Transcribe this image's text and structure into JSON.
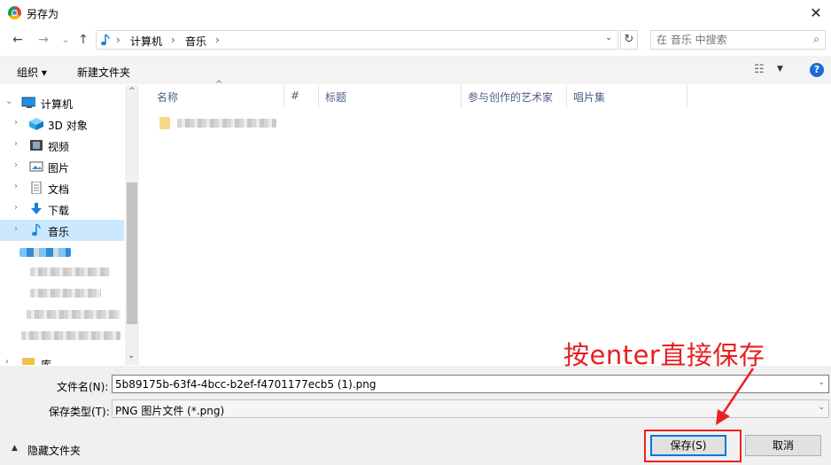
{
  "window": {
    "title": "另存为",
    "close": "✕"
  },
  "nav": {
    "back": "←",
    "forward": "→",
    "recent": "⌄",
    "up": "↑"
  },
  "address": {
    "segments": [
      "计算机",
      "音乐"
    ],
    "sep": "›",
    "dropdown": "⌄",
    "refresh": "↻"
  },
  "search": {
    "placeholder": "在 音乐 中搜索",
    "icon": "⌕"
  },
  "toolbar": {
    "organize": "组织 ▾",
    "new_folder": "新建文件夹",
    "help": "?"
  },
  "sidebar": {
    "items": [
      {
        "label": "计算机",
        "icon": "computer-icon"
      },
      {
        "label": "3D 对象",
        "icon": "cube-icon"
      },
      {
        "label": "视频",
        "icon": "video-icon"
      },
      {
        "label": "图片",
        "icon": "pictures-icon"
      },
      {
        "label": "文档",
        "icon": "document-icon"
      },
      {
        "label": "下载",
        "icon": "download-icon"
      },
      {
        "label": "音乐",
        "icon": "music-icon"
      },
      {
        "label": "库",
        "icon": "library-icon"
      }
    ],
    "selected": "音乐"
  },
  "columns": [
    "名称",
    "#",
    "标题",
    "参与创作的艺术家",
    "唱片集"
  ],
  "form": {
    "filename_label": "文件名(N):",
    "filename_value": "5b89175b-63f4-4bcc-b2ef-f4701177ecb5 (1).png",
    "filetype_label": "保存类型(T):",
    "filetype_value": "PNG 图片文件 (*.png)"
  },
  "footer": {
    "hide_folders": "隐藏文件夹",
    "save": "保存(S)",
    "cancel": "取消"
  },
  "annotation": {
    "text": "按enter直接保存"
  },
  "colors": {
    "selection": "#cce8ff",
    "annotation": "#e62020",
    "accent": "#0078d7"
  }
}
